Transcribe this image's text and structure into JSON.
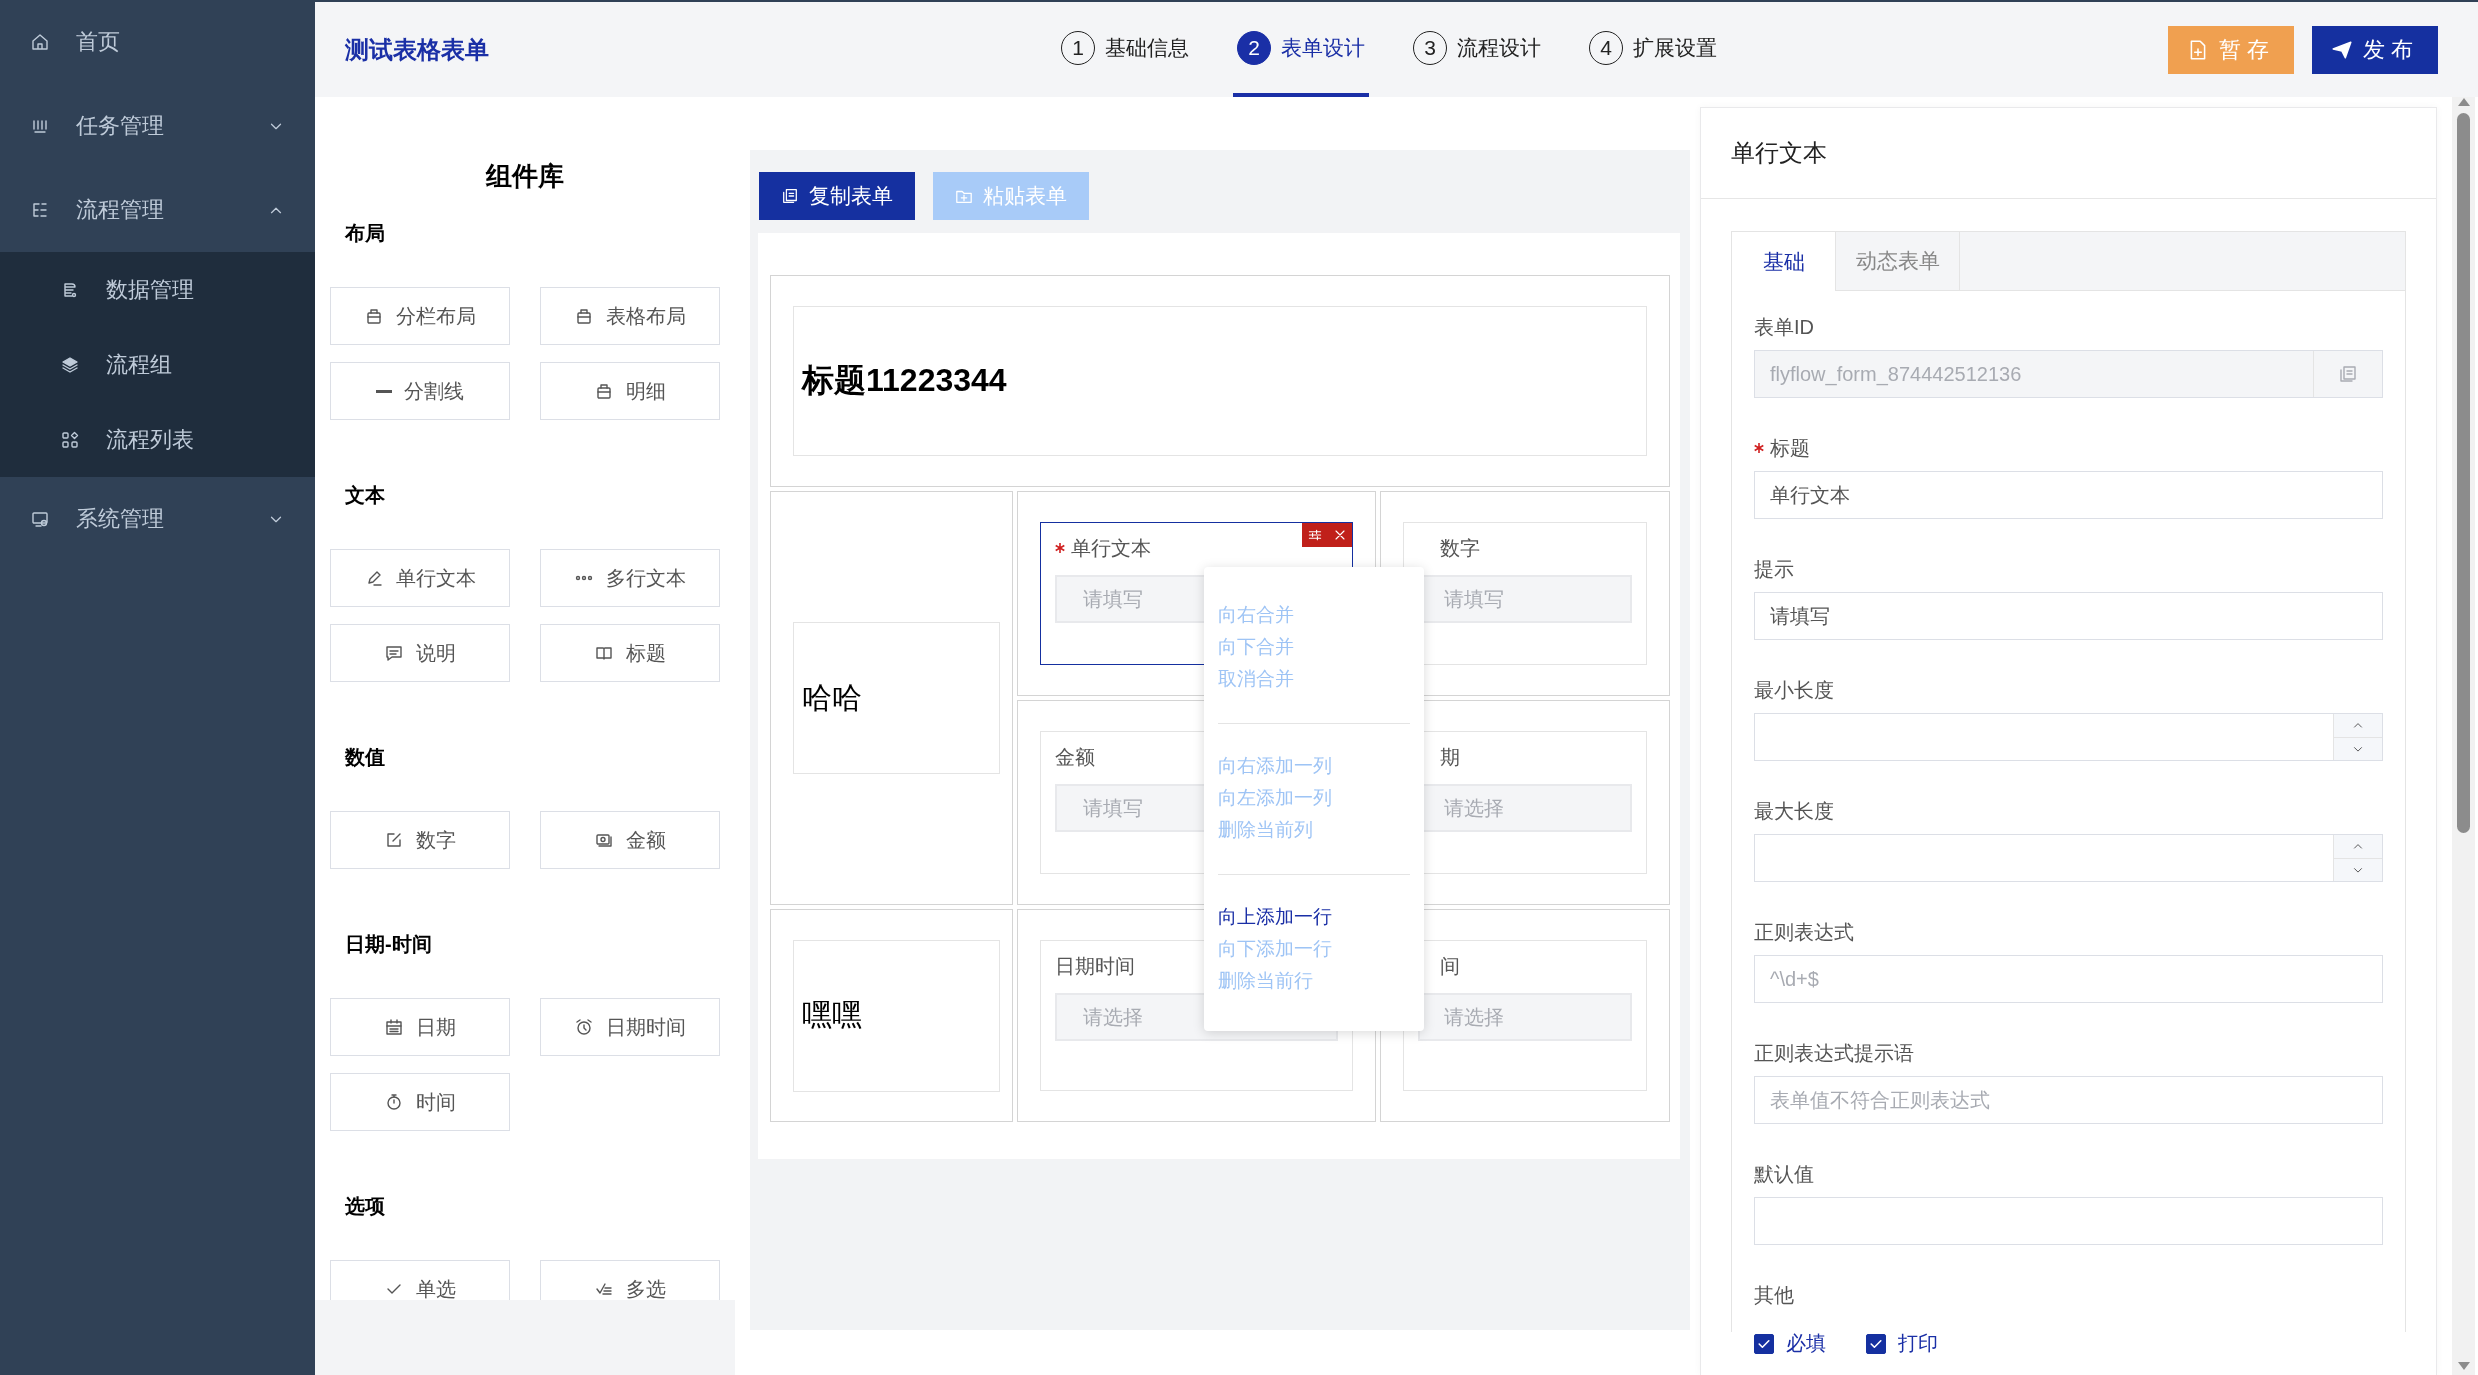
{
  "sidebar": {
    "items": [
      {
        "label": "首页"
      },
      {
        "label": "任务管理",
        "expanded": false
      },
      {
        "label": "流程管理",
        "expanded": true,
        "children": [
          {
            "label": "数据管理"
          },
          {
            "label": "流程组"
          },
          {
            "label": "流程列表"
          }
        ]
      },
      {
        "label": "系统管理",
        "expanded": false
      }
    ]
  },
  "header": {
    "title": "测试表格表单",
    "steps": [
      {
        "number": "1",
        "label": "基础信息",
        "selected": false
      },
      {
        "number": "2",
        "label": "表单设计",
        "selected": true
      },
      {
        "number": "3",
        "label": "流程设计",
        "selected": false
      },
      {
        "number": "4",
        "label": "扩展设置",
        "selected": false
      }
    ],
    "buttons": [
      {
        "label": "暂存",
        "kind": "save"
      },
      {
        "label": "发布",
        "kind": "publish"
      }
    ]
  },
  "library": {
    "title": "组件库",
    "groups": [
      {
        "label": "布局",
        "items": [
          "分栏布局",
          "表格布局",
          "分割线",
          "明细"
        ]
      },
      {
        "label": "文本",
        "items": [
          "单行文本",
          "多行文本",
          "说明",
          "标题"
        ]
      },
      {
        "label": "数值",
        "items": [
          "数字",
          "金额"
        ]
      },
      {
        "label": "日期-时间",
        "items": [
          "日期",
          "日期时间",
          "时间"
        ]
      },
      {
        "label": "选项",
        "items": [
          "单选",
          "多选"
        ]
      }
    ]
  },
  "canvas": {
    "toolbar": [
      {
        "label": "复制表单",
        "disabled": false
      },
      {
        "label": "粘贴表单",
        "disabled": true
      }
    ],
    "cells": [
      {
        "kind": "title",
        "text": "标题11223344"
      },
      {
        "kind": "text_tall",
        "text": "哈哈"
      },
      {
        "kind": "field",
        "label": "单行文本",
        "required": true,
        "selected": true,
        "placeholder": "请填写"
      },
      {
        "kind": "field",
        "label": "数字",
        "required": false,
        "selected": false,
        "placeholder": "请填写"
      },
      {
        "kind": "field",
        "label": "金额",
        "required": false,
        "selected": false,
        "placeholder": "请填写"
      },
      {
        "kind": "field",
        "label": "期",
        "required": false,
        "selected": false,
        "placeholder": "请选择"
      },
      {
        "kind": "text",
        "text": "嘿嘿"
      },
      {
        "kind": "field",
        "label": "日期时间",
        "required": false,
        "selected": false,
        "placeholder": "请选择"
      },
      {
        "kind": "field",
        "label": "间",
        "required": false,
        "selected": false,
        "placeholder": "请选择"
      }
    ],
    "context_menu": [
      [
        {
          "label": "向右合并",
          "disabled": true
        },
        {
          "label": "向下合并",
          "disabled": true
        },
        {
          "label": "取消合并",
          "disabled": true
        }
      ],
      [
        {
          "label": "向右添加一列",
          "disabled": true
        },
        {
          "label": "向左添加一列",
          "disabled": true
        },
        {
          "label": "删除当前列",
          "disabled": true
        }
      ],
      [
        {
          "label": "向上添加一行",
          "disabled": false
        },
        {
          "label": "向下添加一行",
          "disabled": true
        },
        {
          "label": "删除当前行",
          "disabled": true
        }
      ]
    ]
  },
  "properties": {
    "title": "单行文本",
    "tabs": [
      {
        "label": "基础",
        "selected": true
      },
      {
        "label": "动态表单",
        "selected": false
      }
    ],
    "fields": [
      {
        "kind": "text",
        "label": "表单ID",
        "required": false,
        "disabled": true,
        "value": "flyflow_form_874442512136"
      },
      {
        "kind": "text",
        "label": "标题",
        "required": true,
        "disabled": false,
        "value": "单行文本"
      },
      {
        "kind": "text",
        "label": "提示",
        "required": false,
        "disabled": false,
        "value": "请填写"
      },
      {
        "kind": "number",
        "label": "最小长度",
        "required": false
      },
      {
        "kind": "number",
        "label": "最大长度",
        "required": false
      },
      {
        "kind": "text",
        "label": "正则表达式",
        "required": false,
        "disabled": false,
        "placeholder": "^\\d+$"
      },
      {
        "kind": "text",
        "label": "正则表达式提示语",
        "required": false,
        "disabled": false,
        "placeholder": "表单值不符合正则表达式"
      },
      {
        "kind": "text",
        "label": "默认值",
        "required": false,
        "disabled": false
      },
      {
        "kind": "checks",
        "label": "其他",
        "options": [
          {
            "label": "必填",
            "checked": true
          },
          {
            "label": "打印",
            "checked": true
          }
        ]
      }
    ]
  }
}
